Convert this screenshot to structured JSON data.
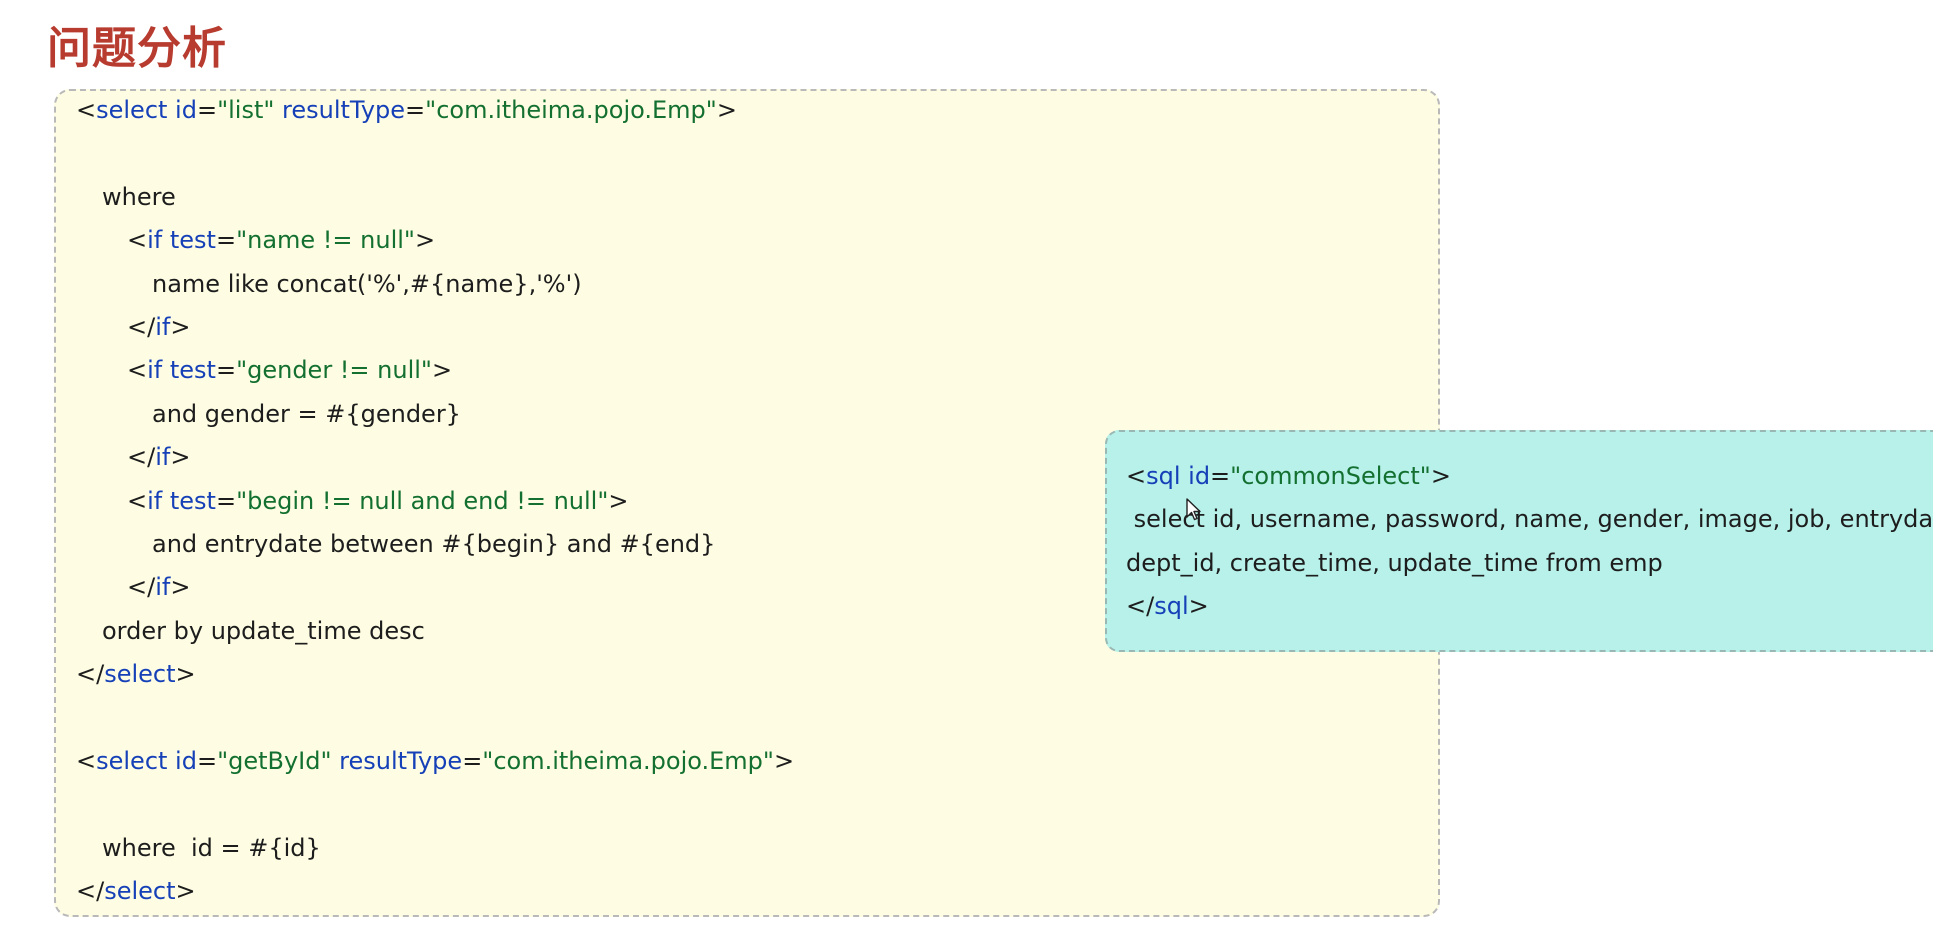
{
  "heading": "问题分析",
  "code": {
    "l1": {
      "open": "<",
      "tag": "select",
      "a1": " id",
      "eq1": "=",
      "v1": "\"list\"",
      "a2": " resultType",
      "eq2": "=",
      "v2": "\"com.itheima.pojo.Emp\"",
      "close": ">"
    },
    "l2": "where",
    "l3": {
      "open": "<",
      "tag": "if",
      "a1": " test",
      "eq1": "=",
      "v1": "\"name != null\"",
      "close": ">"
    },
    "l4": "name like concat('%',#{name},'%')",
    "l5": {
      "open": "</",
      "tag": "if",
      "close": ">"
    },
    "l6": {
      "open": "<",
      "tag": "if",
      "a1": " test",
      "eq1": "=",
      "v1": "\"gender != null\"",
      "close": ">"
    },
    "l7": "and gender = #{gender}",
    "l8": {
      "open": "</",
      "tag": "if",
      "close": ">"
    },
    "l9": {
      "open": "<",
      "tag": "if",
      "a1": " test",
      "eq1": "=",
      "v1": "\"begin != null and end != null\"",
      "close": ">"
    },
    "l10": "and entrydate between #{begin} and #{end}",
    "l11": {
      "open": "</",
      "tag": "if",
      "close": ">"
    },
    "l12": "order by update_time desc",
    "l13": {
      "open": "</",
      "tag": "select",
      "close": ">"
    },
    "l14": {
      "open": "<",
      "tag": "select",
      "a1": " id",
      "eq1": "=",
      "v1": "\"getById\"",
      "a2": " resultType",
      "eq2": "=",
      "v2": "\"com.itheima.pojo.Emp\"",
      "close": ">"
    },
    "l15": "where  id = #{id}",
    "l16": {
      "open": "</",
      "tag": "select",
      "close": ">"
    }
  },
  "sql": {
    "l1": {
      "open": "<",
      "tag": "sql",
      "a1": " id",
      "eq1": "=",
      "v1": "\"commonSelect\"",
      "close": ">"
    },
    "l2": " select id, username, password, name, gender, image, job, entrydate,",
    "l3": "dept_id, create_time, update_time from emp",
    "l4": {
      "open": "</",
      "tag": "sql",
      "close": ">"
    }
  },
  "icons": {
    "cursor": "mouse-pointer-icon"
  },
  "colors": {
    "heading": "#b83b2f",
    "tag": "#1640b8",
    "value": "#137030",
    "code_bg": "#fefde3",
    "sql_bg": "#b7f1ea"
  }
}
